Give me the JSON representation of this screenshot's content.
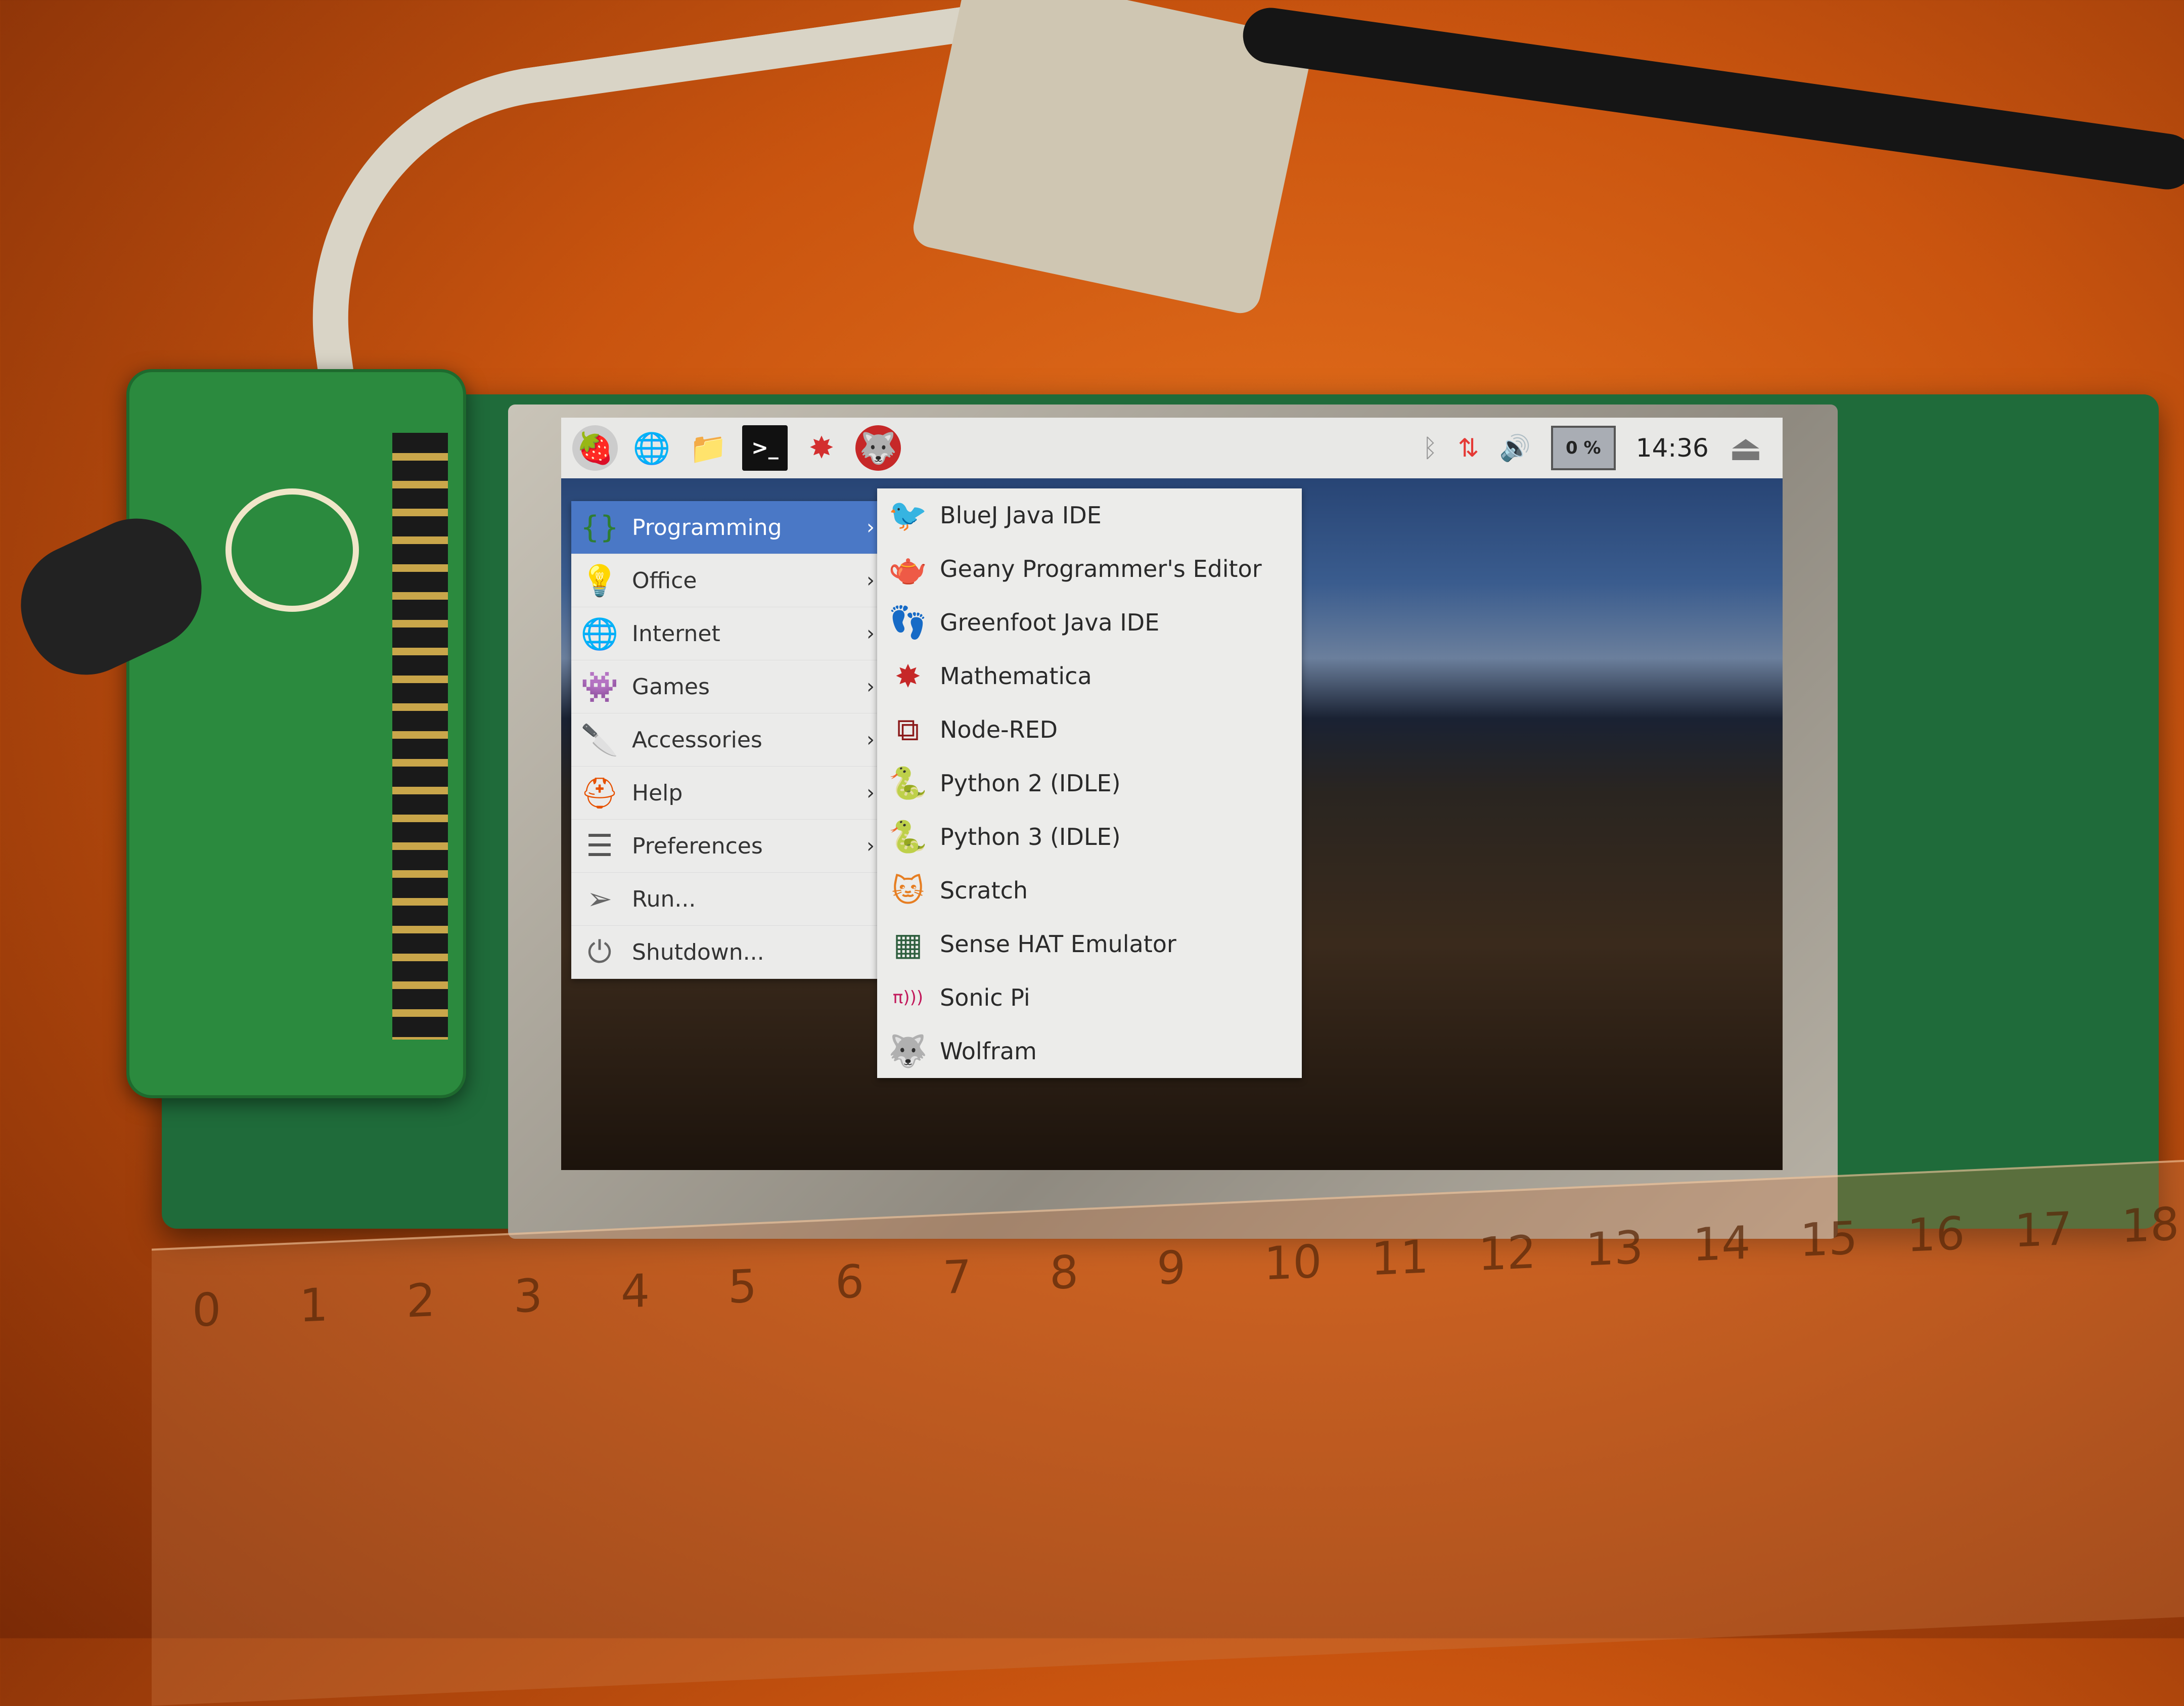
{
  "taskbar": {
    "launchers": [
      {
        "icon": "raspberry-menu-icon",
        "glyph": "🍓"
      },
      {
        "icon": "web-browser-icon",
        "glyph": "🌐"
      },
      {
        "icon": "file-manager-icon",
        "glyph": "📁"
      },
      {
        "icon": "terminal-icon",
        "glyph": ">_"
      },
      {
        "icon": "mathematica-icon",
        "glyph": "✸"
      },
      {
        "icon": "wolfram-icon",
        "glyph": "🐺"
      }
    ],
    "tray": {
      "bluetooth": "ᛒ",
      "network": "⇅",
      "volume": "🔊",
      "cpu_label": "0 %",
      "cpu_percent": 0,
      "clock": "14:36",
      "eject": "⏏"
    }
  },
  "menu": {
    "items": [
      {
        "label": "Programming",
        "icon": "programming-icon",
        "glyph": "{}",
        "color": "#2e7d32",
        "submenu": true,
        "selected": true
      },
      {
        "label": "Office",
        "icon": "office-lamp-icon",
        "glyph": "💡",
        "color": "#c62828",
        "submenu": true
      },
      {
        "label": "Internet",
        "icon": "globe-icon",
        "glyph": "🌐",
        "color": "#1e5fb4",
        "submenu": true
      },
      {
        "label": "Games",
        "icon": "space-invader-icon",
        "glyph": "👾",
        "color": "#4caf50",
        "submenu": true
      },
      {
        "label": "Accessories",
        "icon": "swiss-knife-icon",
        "glyph": "🔪",
        "color": "#d32f2f",
        "submenu": true
      },
      {
        "label": "Help",
        "icon": "lifebuoy-icon",
        "glyph": "⛑",
        "color": "#e65100",
        "submenu": true
      },
      {
        "label": "Preferences",
        "icon": "preferences-icon",
        "glyph": "☰",
        "color": "#555",
        "submenu": true
      },
      {
        "label": "Run...",
        "icon": "paper-plane-icon",
        "glyph": "➢",
        "color": "#666",
        "submenu": false
      },
      {
        "label": "Shutdown...",
        "icon": "power-icon",
        "glyph": "⏻",
        "color": "#666",
        "submenu": false
      }
    ],
    "arrow": "›"
  },
  "submenu": {
    "items": [
      {
        "label": "BlueJ Java IDE",
        "icon": "bluej-icon",
        "glyph": "🐦",
        "color": "#1a3a6a"
      },
      {
        "label": "Geany Programmer's Editor",
        "icon": "geany-teapot-icon",
        "glyph": "🫖",
        "color": "#c9a000"
      },
      {
        "label": "Greenfoot Java IDE",
        "icon": "greenfoot-icon",
        "glyph": "👣",
        "color": "#2e7d32"
      },
      {
        "label": "Mathematica",
        "icon": "mathematica-icon",
        "glyph": "✸",
        "color": "#c62828"
      },
      {
        "label": "Node-RED",
        "icon": "node-red-icon",
        "glyph": "⧉",
        "color": "#8b1a1a"
      },
      {
        "label": "Python 2 (IDLE)",
        "icon": "python-icon",
        "glyph": "🐍",
        "color": "#3a70b0"
      },
      {
        "label": "Python 3 (IDLE)",
        "icon": "python-icon",
        "glyph": "🐍",
        "color": "#3a70b0"
      },
      {
        "label": "Scratch",
        "icon": "scratch-cat-icon",
        "glyph": "🐱",
        "color": "#e67e22"
      },
      {
        "label": "Sense HAT Emulator",
        "icon": "sense-hat-icon",
        "glyph": "▦",
        "color": "#2e5e3e"
      },
      {
        "label": "Sonic Pi",
        "icon": "sonic-pi-icon",
        "glyph": "π)))",
        "color": "#c2185b"
      },
      {
        "label": "Wolfram",
        "icon": "wolfram-icon",
        "glyph": "🐺",
        "color": "#c62828"
      }
    ]
  },
  "ruler": {
    "ticks": [
      "0",
      "1",
      "2",
      "3",
      "4",
      "5",
      "6",
      "7",
      "8",
      "9",
      "10",
      "11",
      "12",
      "13",
      "14",
      "15",
      "16",
      "17",
      "18"
    ]
  }
}
